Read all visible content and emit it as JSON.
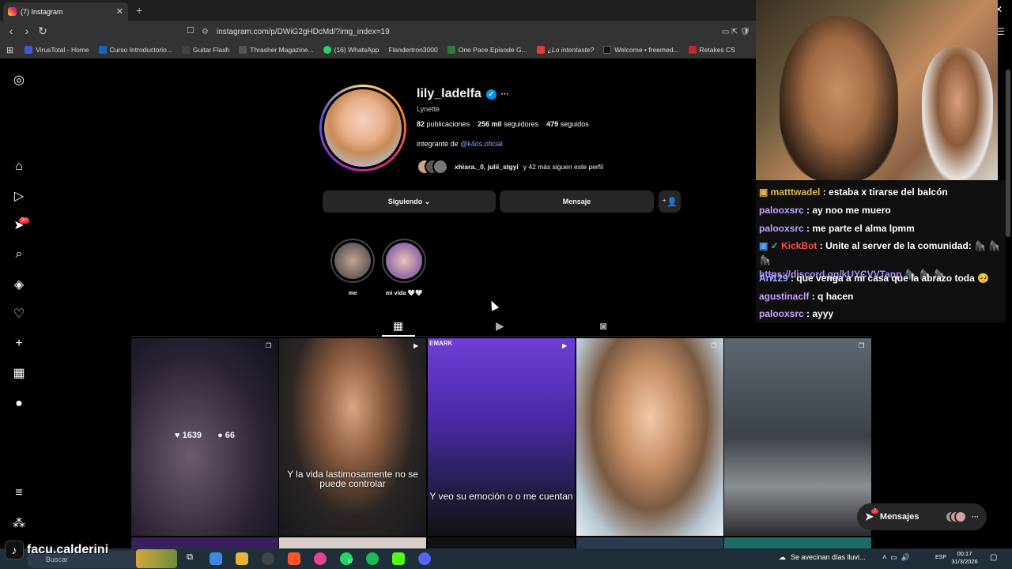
{
  "browser": {
    "tab_title": "(7) Instagram",
    "tab_close": "✕",
    "new_tab": "+",
    "url": "instagram.com/p/DWiG2gHDcMd/?img_index=19",
    "bookmarks": [
      {
        "label": "VirusTotal - Home",
        "color": "#3b5bdb"
      },
      {
        "label": "Curso Introductorio...",
        "color": "#1565c0"
      },
      {
        "label": "Guitar Flash",
        "color": "#444"
      },
      {
        "label": "Thrasher Magazine...",
        "color": "#555"
      },
      {
        "label": "(16) WhatsApp",
        "color": "#25d366"
      },
      {
        "label": "Flandertron3000",
        "color": "#888"
      },
      {
        "label": "One Pace Episode G...",
        "color": "#2e7d32"
      },
      {
        "label": "¿Lo intentaste?",
        "color": "#e53935"
      },
      {
        "label": "Welcome • freemed...",
        "color": "#111"
      },
      {
        "label": "Retakes CS",
        "color": "#c62828"
      }
    ]
  },
  "sidebar": {
    "notif_badge": "9+"
  },
  "profile": {
    "username": "lily_ladelfa",
    "more": "···",
    "full_name": "Lynette",
    "posts_count": "82",
    "posts_label": "publicaciones",
    "followers_count": "256 mil",
    "followers_label": "seguidores",
    "following_count": "479",
    "following_label": "seguidos",
    "bio_prefix": "integrante de",
    "bio_link": "@k4os.oficial",
    "followed_by": "xhiara._0, julii_stgyi",
    "followed_by_suffix": "y 42 más siguen este perfil",
    "btn_following": "Siguiendo ⌄",
    "btn_message": "Mensaje",
    "highlights": [
      {
        "label": "me"
      },
      {
        "label": "mi vida 🤍🤍"
      }
    ]
  },
  "grid": {
    "hover_likes": "1639",
    "hover_comments": "66",
    "captions": [
      "Y la vida lastimosamente no se puede controlar",
      "Y veo su emoción o o me cuentan"
    ],
    "post3_top_text": "EMARK"
  },
  "chat": [
    {
      "user": "matttwadel",
      "text": "estaba x tirarse del balcón"
    },
    {
      "user": "palooxsrc",
      "text": "ay noo me muero"
    },
    {
      "user": "palooxsrc",
      "text": "me parte el alma lpmm"
    },
    {
      "user": "KickBot",
      "text": "Unite al server de la comunidad: 🦍 🦍 🦍",
      "link": "https://discord.gg/kUYCVVTanp",
      "link_suffix": "🦍 🦍 🦍"
    },
    {
      "user": "Ari129",
      "text": "que venga a mi casa que la abrazo toda 🥺"
    },
    {
      "user": "agustinaclf",
      "text": "q hacen"
    },
    {
      "user": "palooxsrc",
      "text": "ayyy"
    }
  ],
  "messages_pill": {
    "label": "Mensajes",
    "badge": "7"
  },
  "overlay": {
    "streamer": "facu.calderini"
  },
  "taskbar": {
    "search_placeholder": "Buscar",
    "weather": "Se avecinan días lluvi...",
    "lang": "ESP",
    "time": "00:17",
    "date": "31/3/2026",
    "whatsapp_badge": "87"
  }
}
